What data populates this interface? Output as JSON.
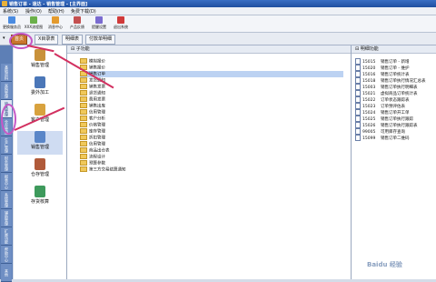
{
  "titlebar": {
    "title": "销售订单 - 速达 - 销售管理 - [主界面]"
  },
  "menu": [
    "系统(S)",
    "操作(O)",
    "帮助(H)",
    "免费下载(D)"
  ],
  "toolbar": {
    "items": [
      {
        "label": "更换服务员",
        "icon": "user-switch-icon",
        "color": "#4a8be0"
      },
      {
        "label": "XXX流程图",
        "icon": "flowchart-icon",
        "color": "#6bb04a"
      },
      {
        "label": "消息中心",
        "icon": "message-icon",
        "color": "#e39a2d"
      },
      {
        "label": "产品反馈",
        "icon": "feedback-icon",
        "color": "#c45050"
      },
      {
        "label": "提醒设置",
        "icon": "alarm-icon",
        "color": "#7a6bd0"
      },
      {
        "label": "退出系统",
        "icon": "exit-icon",
        "color": "#d03a3a"
      }
    ]
  },
  "tabs": [
    {
      "label": "首页"
    },
    {
      "label": "X目录表"
    },
    {
      "label": "明细表"
    },
    {
      "label": "付款单明细"
    }
  ],
  "vtabs": [
    {
      "label": "基础资料"
    },
    {
      "label": "采购管理"
    },
    {
      "label": "销售管理"
    },
    {
      "label": "仓存管理"
    },
    {
      "label": "生产管理"
    },
    {
      "label": "财务管理"
    },
    {
      "label": "报表中心"
    },
    {
      "label": "系统管理"
    },
    {
      "label": "辅助管理"
    },
    {
      "label": "扩展功能"
    },
    {
      "label": "帮助中心"
    },
    {
      "label": "其他"
    }
  ],
  "modules": [
    {
      "label": "销售管理",
      "icon": "sales-icon",
      "color": "#c8913a"
    },
    {
      "label": "委外加工",
      "icon": "outsource-icon",
      "color": "#4b77b8"
    },
    {
      "label": "客户管理",
      "icon": "customer-icon",
      "color": "#d8a23e"
    },
    {
      "label": "销售管理",
      "icon": "sales-mgmt-icon",
      "color": "#5a86c8"
    },
    {
      "label": "仓存管理",
      "icon": "warehouse-icon",
      "color": "#b05a3a"
    },
    {
      "label": "存货核算",
      "icon": "inventory-icon",
      "color": "#3e9a5c"
    }
  ],
  "mid": {
    "header": "子功能",
    "folders": [
      "模拟报价",
      "销售报价",
      "销售订单",
      "发货通知",
      "销售发票",
      "退货通知",
      "费用发票",
      "销售出库",
      "信用管理",
      "客户分析",
      "价格管理",
      "库存管理",
      "折扣管理",
      "信用管理",
      "商品出仓表",
      "流程设计",
      "预算参数",
      "第三方交易结算通知"
    ],
    "selected_index": 2
  },
  "right": {
    "header": "明细功能",
    "items": [
      {
        "code": "15015",
        "name": "销售订单 - 新增"
      },
      {
        "code": "15020",
        "name": "销售订单 - 维护"
      },
      {
        "code": "15016",
        "name": "销售订单统计表"
      },
      {
        "code": "15018",
        "name": "销售订单执行情况汇总表"
      },
      {
        "code": "15003",
        "name": "销售订单执行明细表"
      },
      {
        "code": "15021",
        "name": "虚拟商品订单统计表"
      },
      {
        "code": "15022",
        "name": "订单状态跟踪表"
      },
      {
        "code": "15023",
        "name": "订单预评估表"
      },
      {
        "code": "15024",
        "name": "销售订单开工单"
      },
      {
        "code": "15025",
        "name": "销售订单执行跟踪"
      },
      {
        "code": "15026",
        "name": "销售订单执行跟踪表"
      },
      {
        "code": "99005",
        "name": "可用库存查询"
      },
      {
        "code": "15099",
        "name": "销售订单二维码"
      }
    ]
  },
  "watermark": "Baidu 经验",
  "annotation_color": "#d23060"
}
